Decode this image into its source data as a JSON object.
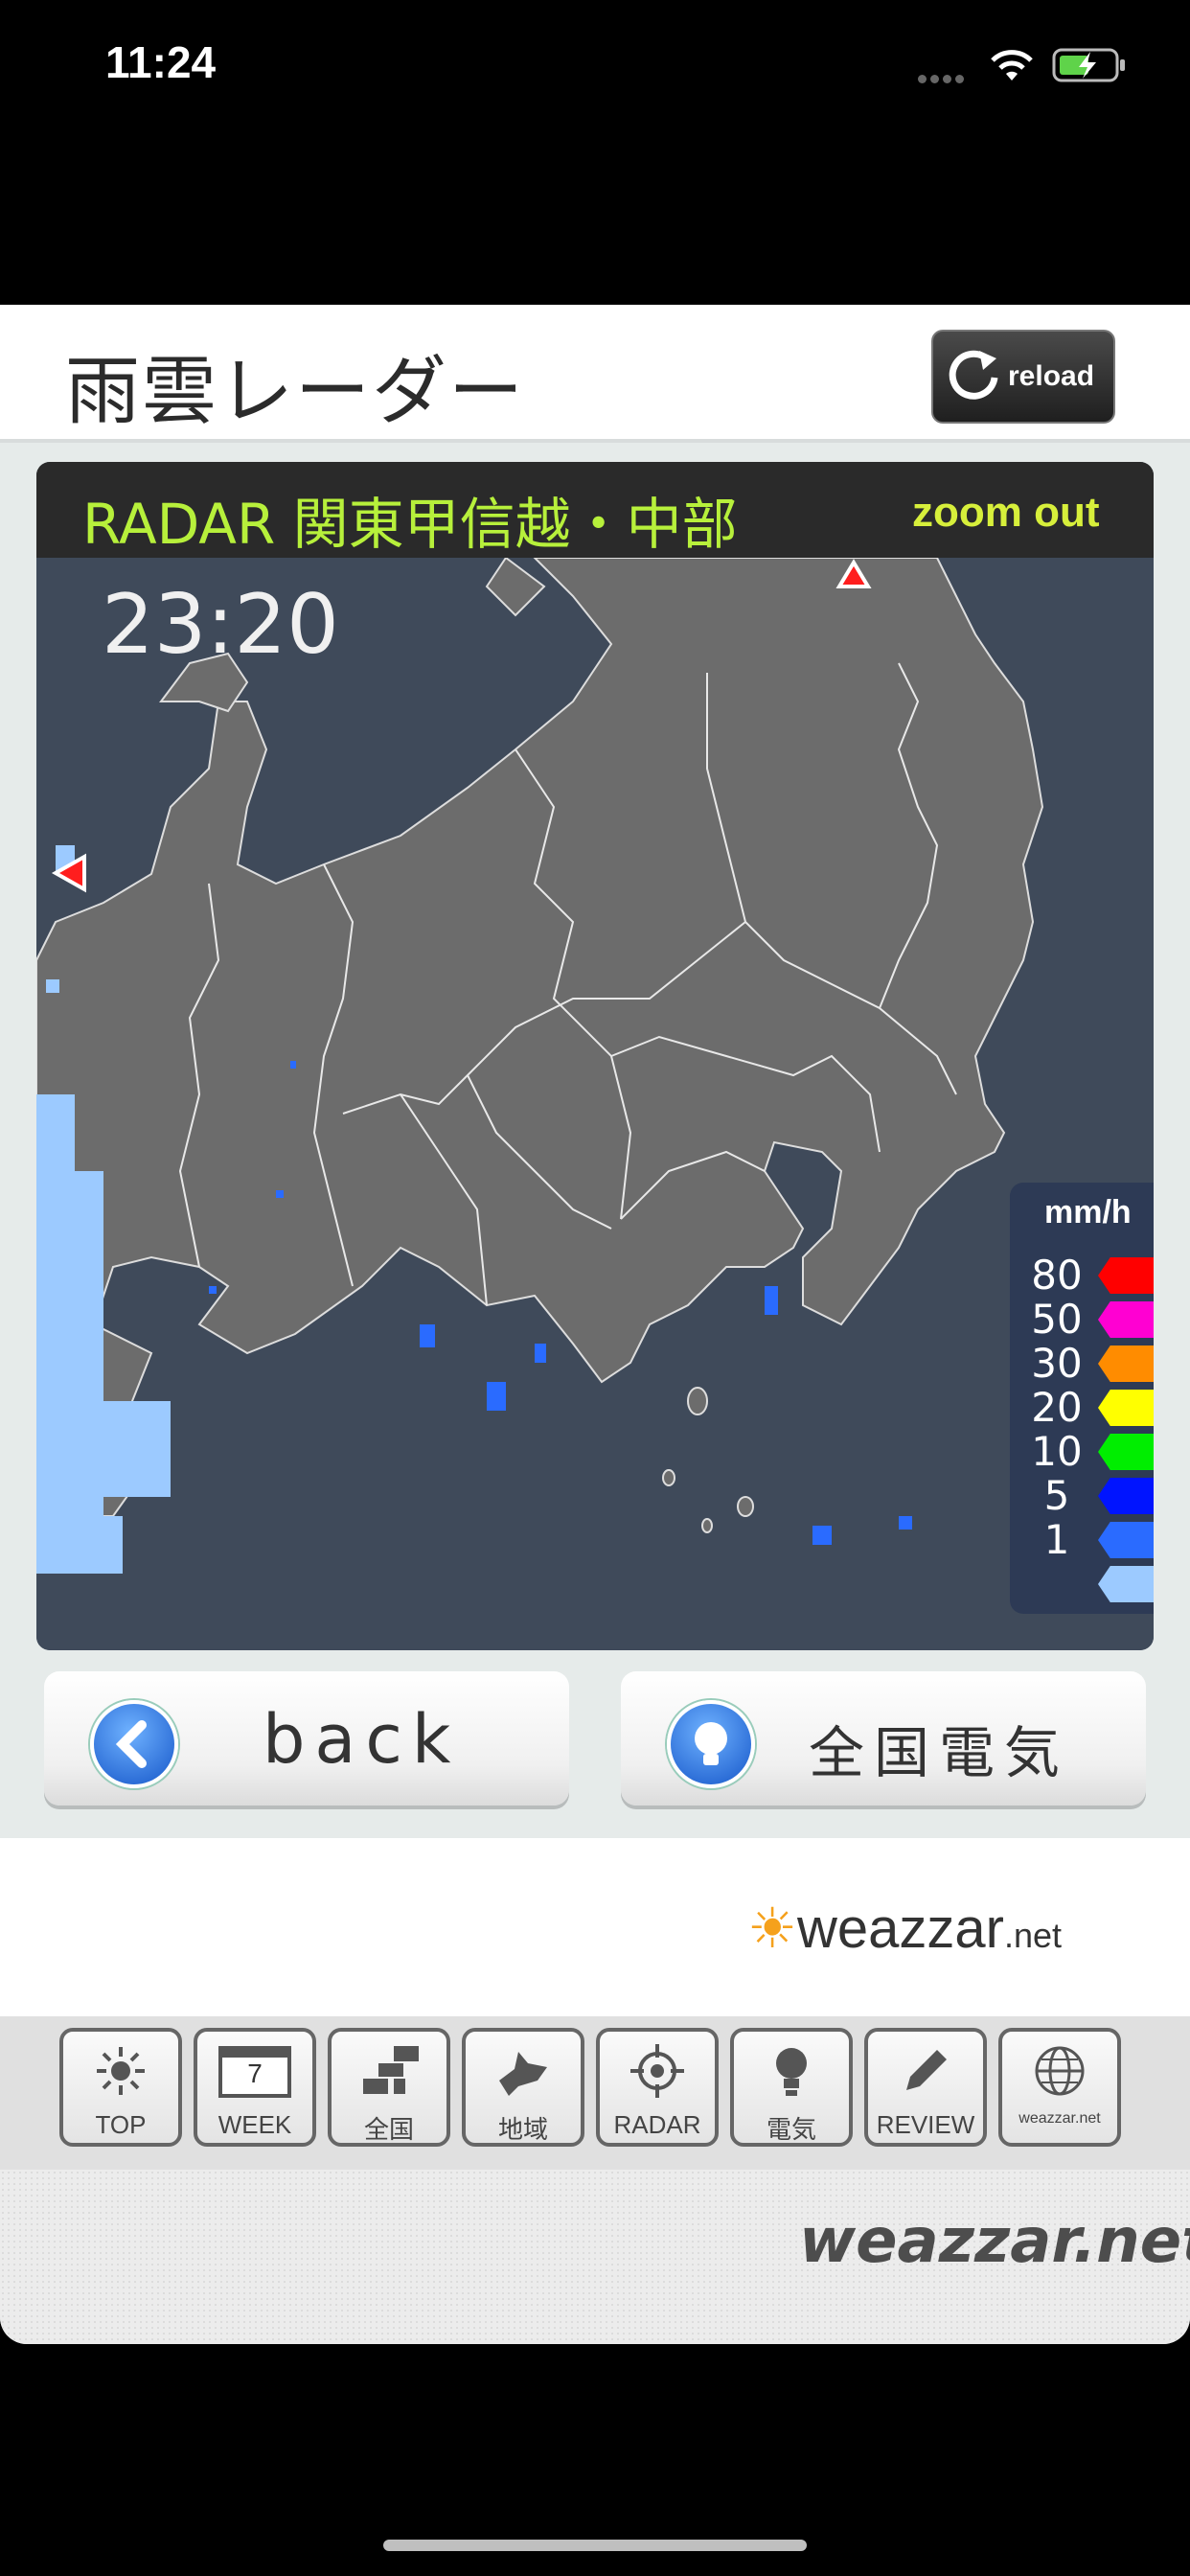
{
  "status_bar": {
    "time": "11:24"
  },
  "header": {
    "title": "雨雲レーダー",
    "reload_label": "reload"
  },
  "radar": {
    "title": "RADAR 関東甲信越・中部",
    "zoom_label": "zoom out",
    "time": "23:20",
    "legend": {
      "unit": "mm/h",
      "items": [
        {
          "label": "80",
          "color": "#ff0000"
        },
        {
          "label": "50",
          "color": "#ff00d2"
        },
        {
          "label": "30",
          "color": "#ff8c00"
        },
        {
          "label": "20",
          "color": "#ffff00"
        },
        {
          "label": "10",
          "color": "#00ee00"
        },
        {
          "label": "5",
          "color": "#0014ff"
        },
        {
          "label": "1",
          "color": "#2a6bff"
        },
        {
          "label": "",
          "color": "#9ccaff"
        }
      ]
    }
  },
  "buttons": {
    "back": "back",
    "denki": "全国電気"
  },
  "logo_small": "weazzar",
  "logo_small_suffix": ".net",
  "nav": [
    {
      "label": "TOP",
      "icon": "sun-icon"
    },
    {
      "label": "WEEK",
      "icon": "calendar-icon",
      "badge": "7"
    },
    {
      "label": "全国",
      "icon": "japan-blocks-icon"
    },
    {
      "label": "地域",
      "icon": "hokkaido-icon"
    },
    {
      "label": "RADAR",
      "icon": "crosshair-icon"
    },
    {
      "label": "電気",
      "icon": "lightbulb-icon"
    },
    {
      "label": "REVIEW",
      "icon": "pencil-icon"
    },
    {
      "label": "weazzar.net",
      "icon": "globe-icon"
    }
  ],
  "logo_big": "weazzar.net"
}
